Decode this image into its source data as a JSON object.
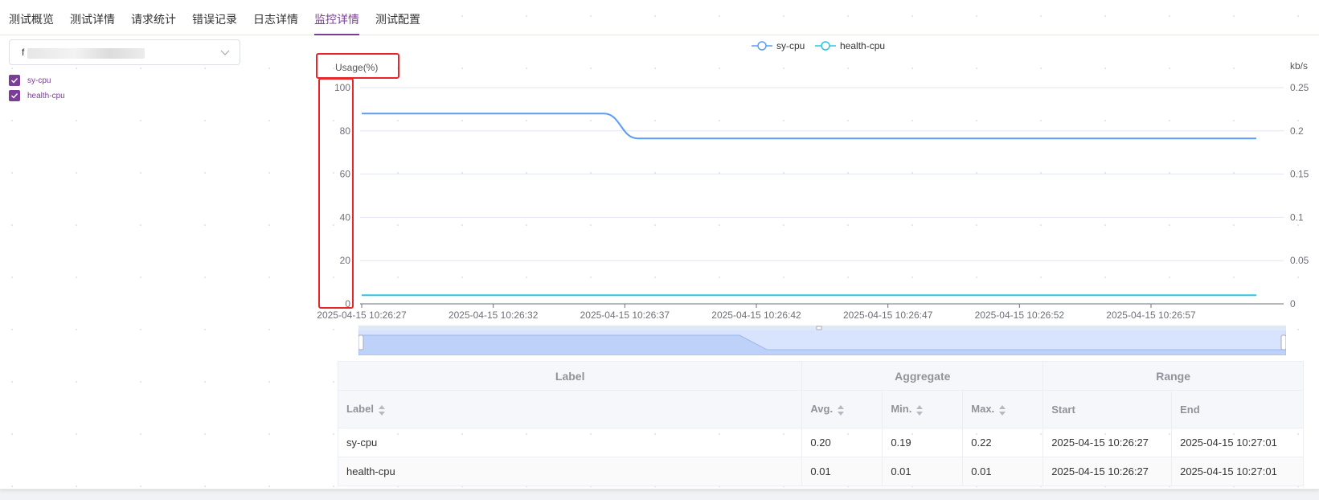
{
  "tabs": [
    {
      "label": "测试概览",
      "active": false
    },
    {
      "label": "测试详情",
      "active": false
    },
    {
      "label": "请求统计",
      "active": false
    },
    {
      "label": "错误记录",
      "active": false
    },
    {
      "label": "日志详情",
      "active": false
    },
    {
      "label": "监控详情",
      "active": true
    },
    {
      "label": "测试配置",
      "active": false
    }
  ],
  "selector": {
    "value": "f",
    "icon": "chevron-down-icon"
  },
  "checkboxes": [
    {
      "label": "sy-cpu",
      "checked": true
    },
    {
      "label": "health-cpu",
      "checked": true
    }
  ],
  "colors": {
    "accent": "#7a3e96",
    "sy_cpu": "#5b9cf5",
    "health_cpu": "#2bc6e0",
    "highlight": "#e8262a"
  },
  "chart_data": {
    "type": "line",
    "legend": [
      "sy-cpu",
      "health-cpu"
    ],
    "legend_position": "top-center",
    "y_left": {
      "label": "Usage(%)",
      "ticks": [
        "100",
        "80",
        "60",
        "40",
        "20",
        "0"
      ],
      "min": 0,
      "max": 100
    },
    "y_right": {
      "label": "kb/s",
      "ticks": [
        "0.25",
        "0.2",
        "0.15",
        "0.1",
        "0.05",
        "0"
      ],
      "min": 0,
      "max": 0.25
    },
    "x_ticks": [
      "2025-04-15 10:26:27",
      "2025-04-15 10:26:32",
      "2025-04-15 10:26:37",
      "2025-04-15 10:26:42",
      "2025-04-15 10:26:47",
      "2025-04-15 10:26:52",
      "2025-04-15 10:26:57"
    ],
    "x_range": [
      "2025-04-15 10:26:27",
      "2025-04-15 10:27:01"
    ],
    "grid": true,
    "series": [
      {
        "name": "sy-cpu",
        "color": "#5b9cf5",
        "points": [
          [
            0,
            88
          ],
          [
            9.2,
            88
          ],
          [
            10.5,
            76.5
          ],
          [
            34,
            76.5
          ]
        ]
      },
      {
        "name": "health-cpu",
        "color": "#2bc6e0",
        "points": [
          [
            0,
            4
          ],
          [
            34,
            4
          ]
        ]
      }
    ]
  },
  "table": {
    "group_headers": [
      "Label",
      "Aggregate",
      "Range"
    ],
    "columns": [
      "Label",
      "Avg.",
      "Min.",
      "Max.",
      "Start",
      "End"
    ],
    "rows": [
      [
        "sy-cpu",
        "0.20",
        "0.19",
        "0.22",
        "2025-04-15 10:26:27",
        "2025-04-15 10:27:01"
      ],
      [
        "health-cpu",
        "0.01",
        "0.01",
        "0.01",
        "2025-04-15 10:26:27",
        "2025-04-15 10:27:01"
      ]
    ]
  }
}
